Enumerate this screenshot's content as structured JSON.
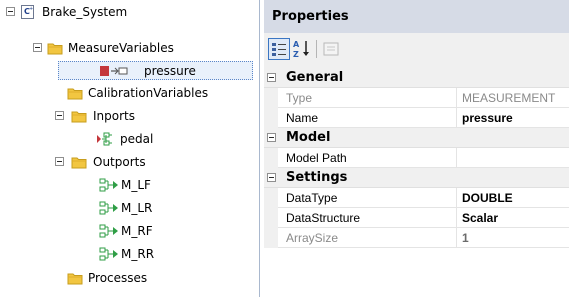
{
  "tree": {
    "root": "Brake_System",
    "items": [
      {
        "label": "MeasureVariables"
      },
      {
        "label": "pressure"
      },
      {
        "label": "CalibrationVariables"
      },
      {
        "label": "Inports"
      },
      {
        "label": "pedal"
      },
      {
        "label": "Outports"
      },
      {
        "label": "M_LF"
      },
      {
        "label": "M_LR"
      },
      {
        "label": "M_RF"
      },
      {
        "label": "M_RR"
      },
      {
        "label": "Processes"
      }
    ]
  },
  "properties": {
    "title": "Properties",
    "categories": [
      {
        "label": "General",
        "rows": [
          {
            "name": "Type",
            "value": "MEASUREMENT"
          },
          {
            "name": "Name",
            "value": "pressure"
          }
        ]
      },
      {
        "label": "Model",
        "rows": [
          {
            "name": "Model Path",
            "value": ""
          }
        ]
      },
      {
        "label": "Settings",
        "rows": [
          {
            "name": "DataType",
            "value": "DOUBLE"
          },
          {
            "name": "DataStructure",
            "value": "Scalar"
          },
          {
            "name": "ArraySize",
            "value": "1"
          }
        ]
      }
    ]
  },
  "colors": {
    "folder": "#f2c641",
    "selection_bg": "#e9f1fb",
    "properties_header": "#d6dbe6",
    "port_green": "#2f9e46",
    "measure_red": "#c4373b"
  }
}
